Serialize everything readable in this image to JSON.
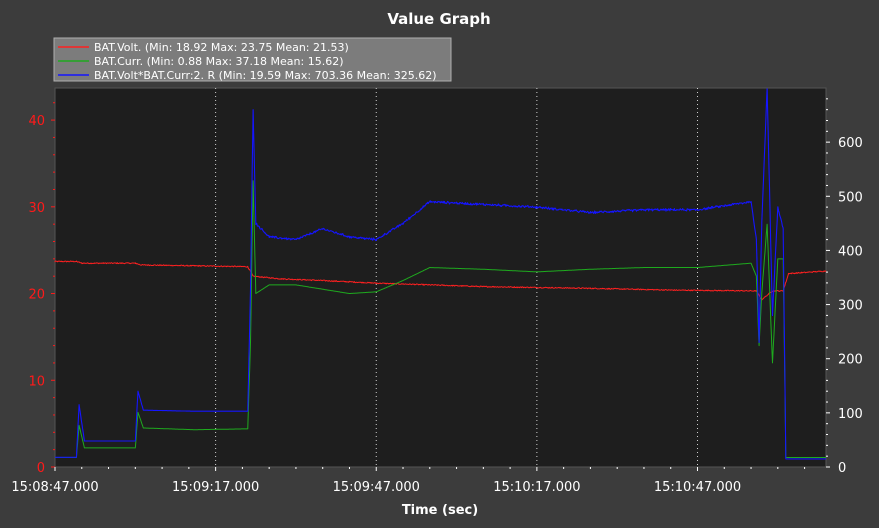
{
  "chart_data": {
    "type": "line",
    "title": "Value Graph",
    "xlabel": "Time (sec)",
    "x_ticks": [
      "15:08:47.000",
      "15:09:17.000",
      "15:09:47.000",
      "15:10:17.000",
      "15:10:47.000"
    ],
    "x_tick_seconds": [
      0,
      30,
      60,
      90,
      120
    ],
    "xlim": [
      0,
      144
    ],
    "y_left": {
      "ticks": [
        0,
        10,
        20,
        30,
        40
      ],
      "range": [
        0,
        43.7
      ],
      "color": "#ff1a1a"
    },
    "y_right": {
      "ticks": [
        0,
        100,
        200,
        300,
        400,
        500,
        600
      ],
      "range": [
        0,
        700
      ],
      "color": "#ffffff"
    },
    "grid": "vertical-dotted",
    "legend_position": "top-left",
    "series": [
      {
        "name": "BAT.Volt. (Min: 18.92 Max: 23.75 Mean: 21.53)",
        "color": "#ff2020",
        "axis": "left",
        "points": [
          [
            0,
            23.7
          ],
          [
            4,
            23.7
          ],
          [
            5,
            23.5
          ],
          [
            15,
            23.5
          ],
          [
            16,
            23.3
          ],
          [
            26,
            23.2
          ],
          [
            36,
            23.1
          ],
          [
            37,
            22.0
          ],
          [
            42,
            21.7
          ],
          [
            50,
            21.5
          ],
          [
            60,
            21.2
          ],
          [
            70,
            21.0
          ],
          [
            80,
            20.8
          ],
          [
            100,
            20.6
          ],
          [
            115,
            20.4
          ],
          [
            131,
            20.3
          ],
          [
            132,
            19.3
          ],
          [
            134,
            20.3
          ],
          [
            136,
            20.3
          ],
          [
            137,
            22.3
          ],
          [
            144,
            22.6
          ]
        ]
      },
      {
        "name": "BAT.Curr. (Min: 0.88 Max: 37.18 Mean: 15.62)",
        "color": "#1eaa1e",
        "axis": "left",
        "points": [
          [
            0,
            1.1
          ],
          [
            4,
            1.1
          ],
          [
            4.5,
            4.8
          ],
          [
            5.5,
            2.2
          ],
          [
            15,
            2.2
          ],
          [
            15.5,
            6.3
          ],
          [
            16.5,
            4.5
          ],
          [
            26,
            4.3
          ],
          [
            36,
            4.4
          ],
          [
            36.5,
            14.0
          ],
          [
            37,
            33.0
          ],
          [
            37.5,
            20.0
          ],
          [
            40,
            21.0
          ],
          [
            45,
            21.0
          ],
          [
            50,
            20.5
          ],
          [
            55,
            20.0
          ],
          [
            60,
            20.2
          ],
          [
            65,
            21.5
          ],
          [
            70,
            23.0
          ],
          [
            80,
            22.8
          ],
          [
            90,
            22.5
          ],
          [
            100,
            22.8
          ],
          [
            110,
            23.0
          ],
          [
            120,
            23.0
          ],
          [
            130,
            23.5
          ],
          [
            131,
            22.0
          ],
          [
            131.5,
            14.0
          ],
          [
            132,
            20.0
          ],
          [
            133,
            28.0
          ],
          [
            134,
            12.0
          ],
          [
            135,
            24.0
          ],
          [
            136,
            24.0
          ],
          [
            136.5,
            1.1
          ],
          [
            144,
            1.1
          ]
        ]
      },
      {
        "name": "BAT.Volt*BAT.Curr:2. R (Min: 19.59 Max: 703.36 Mean: 325.62)",
        "color": "#1515ff",
        "axis": "right",
        "points": [
          [
            0,
            18
          ],
          [
            4,
            18
          ],
          [
            4.5,
            115
          ],
          [
            5.5,
            48
          ],
          [
            15,
            48
          ],
          [
            15.5,
            140
          ],
          [
            16.5,
            105
          ],
          [
            26,
            103
          ],
          [
            36,
            103
          ],
          [
            36.5,
            320
          ],
          [
            37,
            660
          ],
          [
            37.5,
            450
          ],
          [
            40,
            425
          ],
          [
            45,
            420
          ],
          [
            50,
            440
          ],
          [
            55,
            425
          ],
          [
            60,
            420
          ],
          [
            65,
            450
          ],
          [
            70,
            490
          ],
          [
            80,
            485
          ],
          [
            90,
            480
          ],
          [
            100,
            470
          ],
          [
            110,
            475
          ],
          [
            120,
            475
          ],
          [
            130,
            490
          ],
          [
            131,
            420
          ],
          [
            131.5,
            230
          ],
          [
            132,
            450
          ],
          [
            133,
            700
          ],
          [
            134,
            280
          ],
          [
            135,
            480
          ],
          [
            136,
            440
          ],
          [
            136.5,
            15
          ],
          [
            144,
            15
          ]
        ]
      }
    ],
    "noise_amplitude": [
      0,
      0,
      1.8,
      30
    ]
  }
}
